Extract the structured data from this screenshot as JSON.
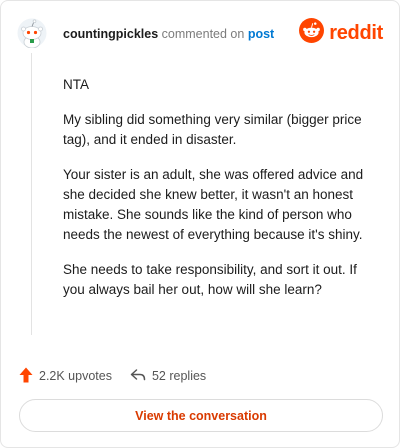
{
  "header": {
    "username": "countingpickles",
    "action_text": "commented on",
    "post_link": "post",
    "logo_text": "reddit"
  },
  "comment": {
    "paragraphs": [
      "NTA",
      "My sibling did something very similar (bigger price tag), and it ended in disaster.",
      "Your sister is an adult, she was offered advice and she decided she knew better, it wasn't an honest mistake. She sounds like the kind of person who needs the newest of everything because it's shiny.",
      "She needs to take responsibility, and sort it out. If you always bail her out, how will she learn?"
    ]
  },
  "stats": {
    "upvotes": "2.2K upvotes",
    "replies": "52 replies"
  },
  "cta": {
    "label": "View the conversation"
  },
  "colors": {
    "accent": "#ff4500",
    "link": "#0079d3",
    "cta_text": "#d93a00"
  },
  "icons": [
    "snoo-avatar-icon",
    "reddit-logo-icon",
    "upvote-arrow-icon",
    "reply-arrow-icon"
  ]
}
